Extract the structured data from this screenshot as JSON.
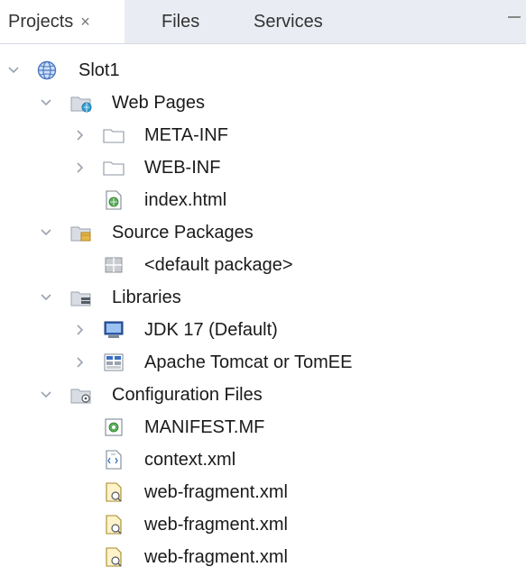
{
  "tabs": [
    {
      "label": "Projects",
      "close": "×"
    },
    {
      "label": "Files"
    },
    {
      "label": "Services"
    }
  ],
  "tree": {
    "project": "Slot1",
    "web_pages": {
      "label": "Web Pages",
      "children": [
        "META-INF",
        "WEB-INF",
        "index.html"
      ]
    },
    "source_packages": {
      "label": "Source Packages",
      "children": [
        "<default package>"
      ]
    },
    "libraries": {
      "label": "Libraries",
      "children": [
        "JDK 17 (Default)",
        "Apache Tomcat or TomEE"
      ]
    },
    "config_files": {
      "label": "Configuration Files",
      "children": [
        "MANIFEST.MF",
        "context.xml",
        "web-fragment.xml",
        "web-fragment.xml",
        "web-fragment.xml"
      ]
    }
  },
  "colors": {
    "tab_bar_bg": "#e9ecf2",
    "chevron": "#9aa3b0",
    "folder": "#d9dde3",
    "globe": "#4a78c2",
    "package_yellow": "#e6b84a"
  }
}
